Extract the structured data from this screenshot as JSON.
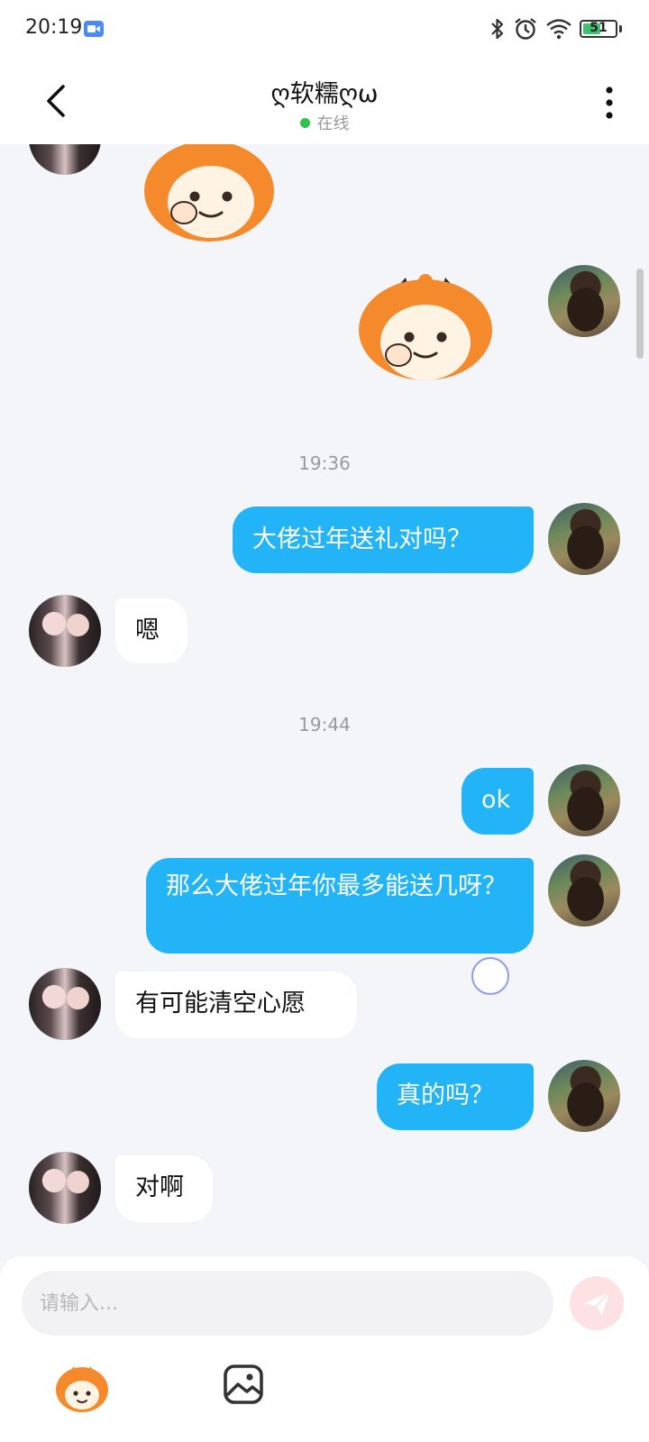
{
  "status_bar": {
    "time": "20:19",
    "battery": "51",
    "battery_level": 0.51
  },
  "header": {
    "title": "ღ软糯ღω",
    "status": "在线"
  },
  "messages": {
    "ts1": "19:36",
    "ts2": "19:44",
    "m1": "大佬过年送礼对吗？",
    "m2": "嗯",
    "m3": "ok",
    "m4": "那么大佬过年你最多能送几呀？",
    "m5": "有可能清空心愿",
    "m6": "真的吗？",
    "m7": "对啊"
  },
  "input": {
    "placeholder": "请输入..."
  },
  "colors": {
    "my_bubble": "#22b4f6",
    "their_bubble": "#ffffff",
    "online": "#2dc24e",
    "send_button": "#fde1e3"
  }
}
